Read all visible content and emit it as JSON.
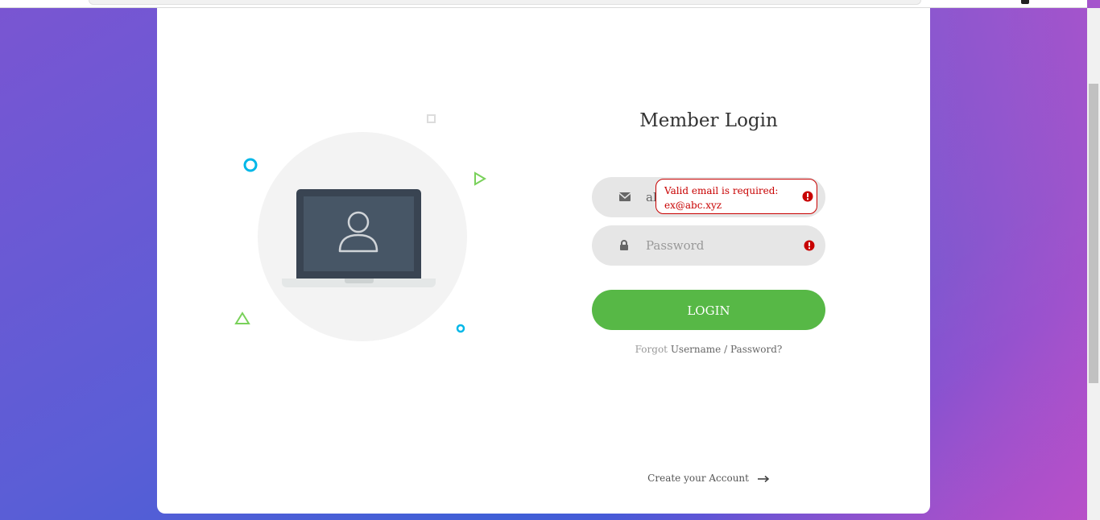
{
  "colors": {
    "accent_green": "#57b846",
    "error_red": "#c80000",
    "cyan_deco": "#00b7e8",
    "green_deco": "#79d15a"
  },
  "login": {
    "title": "Member Login",
    "email_value": "al",
    "email_icon": "envelope-icon",
    "password_placeholder": "Password",
    "password_icon": "lock-icon",
    "login_label": "LOGIN",
    "forgot_prefix": "Forgot",
    "forgot_username": "Username",
    "forgot_sep": "/",
    "forgot_password": "Password?",
    "create_label": "Create your Account"
  },
  "validation": {
    "email_tooltip_line1": "Valid email is required:",
    "email_tooltip_line2": "ex@abc.xyz"
  },
  "illustration": {
    "icon": "user-on-laptop-icon"
  }
}
